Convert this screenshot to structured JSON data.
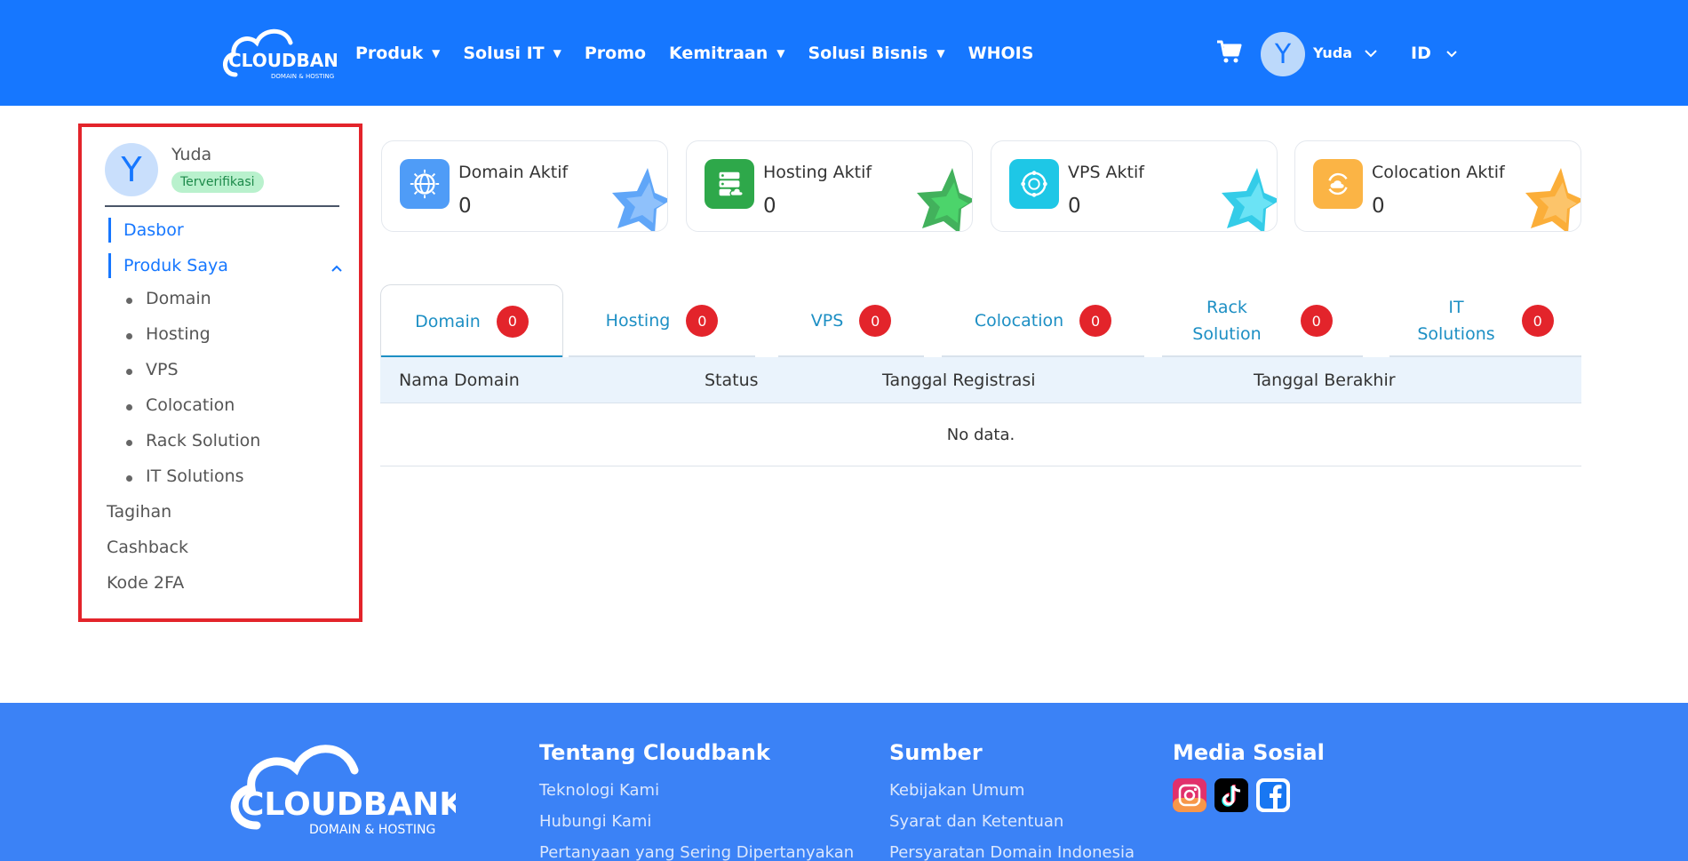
{
  "header": {
    "logo_text": "CLOUDBANK",
    "logo_subtext": "DOMAIN & HOSTING",
    "nav": [
      {
        "label": "Produk",
        "has_caret": true
      },
      {
        "label": "Solusi IT",
        "has_caret": true
      },
      {
        "label": "Promo",
        "has_caret": false
      },
      {
        "label": "Kemitraan",
        "has_caret": true
      },
      {
        "label": "Solusi Bisnis",
        "has_caret": true
      },
      {
        "label": "WHOIS",
        "has_caret": false
      }
    ],
    "avatar_initial": "Y",
    "user_name": "Yuda",
    "language": "ID"
  },
  "sidebar": {
    "avatar_initial": "Y",
    "user_name": "Yuda",
    "verified_badge": "Terverifikasi",
    "dashboard": "Dasbor",
    "my_products": "Produk Saya",
    "sub_items": [
      "Domain",
      "Hosting",
      "VPS",
      "Colocation",
      "Rack Solution",
      "IT Solutions"
    ],
    "billing": "Tagihan",
    "cashback": "Cashback",
    "twofa": "Kode 2FA"
  },
  "stats": [
    {
      "title": "Domain Aktif",
      "value": "0",
      "color": "#4f9cf7",
      "icon": "globe-icon"
    },
    {
      "title": "Hosting Aktif",
      "value": "0",
      "color": "#2ea84a",
      "icon": "server-icon"
    },
    {
      "title": "VPS Aktif",
      "value": "0",
      "color": "#1ec7e6",
      "icon": "network-icon"
    },
    {
      "title": "Colocation Aktif",
      "value": "0",
      "color": "#fbb445",
      "icon": "cloud-sync-icon"
    }
  ],
  "tabs": [
    {
      "line1": "Domain",
      "line2": "",
      "count": "0"
    },
    {
      "line1": "Hosting",
      "line2": "",
      "count": "0"
    },
    {
      "line1": "VPS",
      "line2": "",
      "count": "0"
    },
    {
      "line1": "Colocation",
      "line2": "",
      "count": "0"
    },
    {
      "line1": "Rack",
      "line2": "Solution",
      "count": "0"
    },
    {
      "line1": "IT",
      "line2": "Solutions",
      "count": "0"
    }
  ],
  "table": {
    "columns": [
      "Nama Domain",
      "Status",
      "Tanggal Registrasi",
      "Tanggal Berakhir"
    ],
    "empty_text": "No data."
  },
  "footer": {
    "logo_text": "CLOUDBANK",
    "logo_subtext": "DOMAIN & HOSTING",
    "about_title": "Tentang Cloudbank",
    "about_links": [
      "Teknologi Kami",
      "Hubungi Kami",
      "Pertanyaan yang Sering Dipertanyakan"
    ],
    "resources_title": "Sumber",
    "resources_links": [
      "Kebijakan Umum",
      "Syarat dan Ketentuan",
      "Persyaratan Domain Indonesia"
    ],
    "social_title": "Media Sosial",
    "social": [
      "instagram-icon",
      "tiktok-icon",
      "facebook-icon"
    ]
  },
  "colors": {
    "brand": "#1677ff",
    "footer": "#3b82f6",
    "badge_red": "#e3242b",
    "highlight_border": "#e3242b"
  }
}
